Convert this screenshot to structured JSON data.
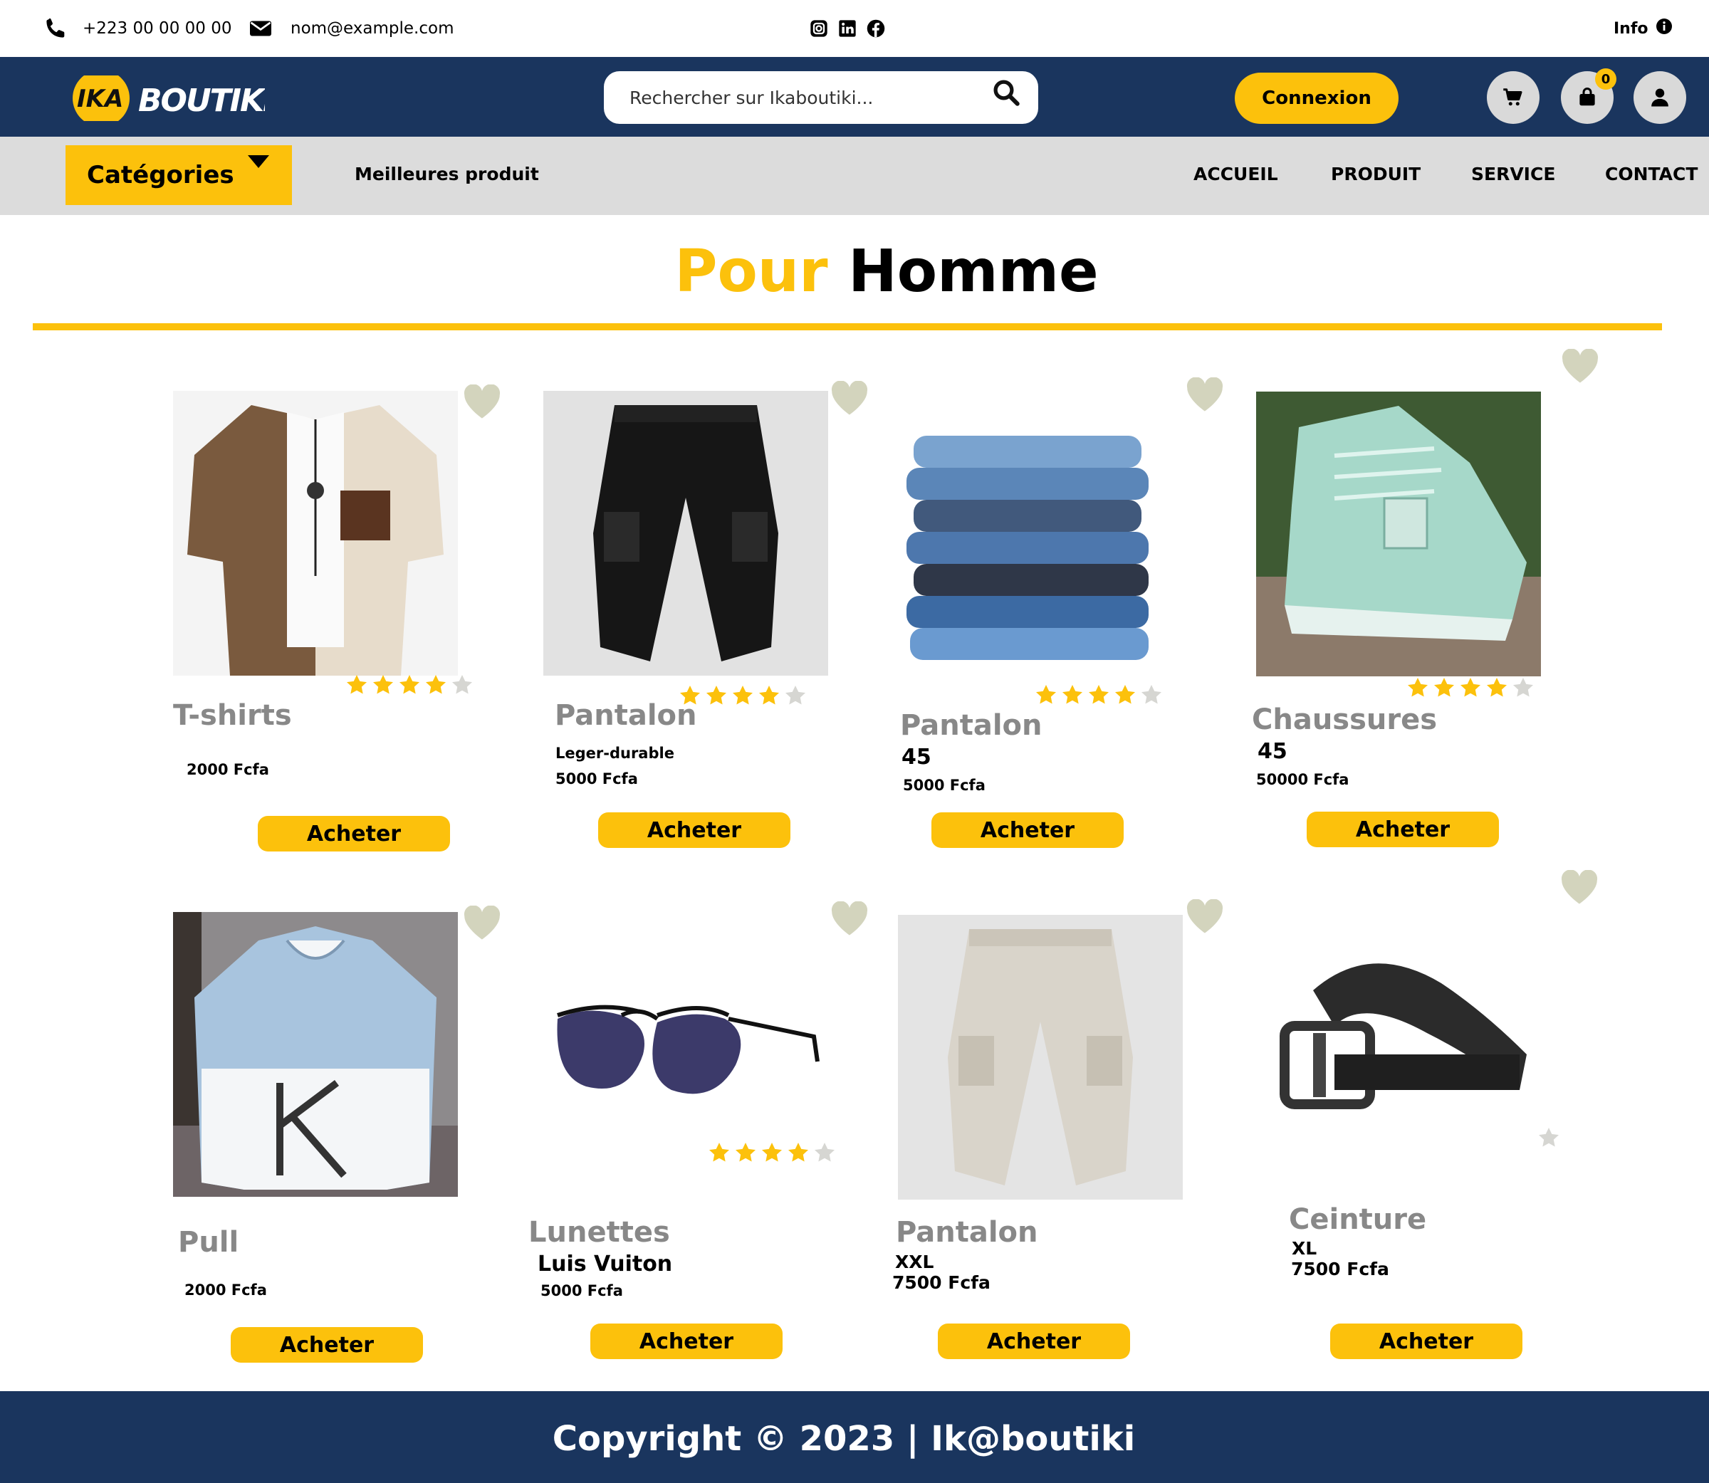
{
  "topbar": {
    "phone": "+223 00 00 00 00",
    "email": "nom@example.com",
    "social_icons": [
      "instagram-icon",
      "linkedin-icon",
      "facebook-icon"
    ],
    "info_label": "Info"
  },
  "header": {
    "logo_alt": "IKA BOUTIKI",
    "search_placeholder": "Rechercher sur Ikaboutiki...",
    "login_label": "Connexion",
    "bag_count": "0"
  },
  "nav": {
    "categories_label": "Catégories",
    "best_label": "Meilleures produit",
    "menu": [
      "ACCUEIL",
      "PRODUIT",
      "SERVICE",
      "CONTACT"
    ]
  },
  "section": {
    "title_part1": "Pour",
    "title_part2": "Homme"
  },
  "products": [
    {
      "name": "T-shirts",
      "detail": "",
      "price": "2000 Fcfa",
      "rating": 4,
      "buy": "Acheter"
    },
    {
      "name": "Pantalon",
      "detail": "Leger-durable",
      "price": "5000 Fcfa",
      "rating": 4,
      "buy": "Acheter"
    },
    {
      "name": "Pantalon",
      "detail": "45",
      "price": "5000 Fcfa",
      "rating": 4,
      "buy": "Acheter"
    },
    {
      "name": "Chaussures",
      "detail": "45",
      "price": "50000 Fcfa",
      "rating": 4,
      "buy": "Acheter"
    },
    {
      "name": "Pull",
      "detail": "",
      "price": "2000 Fcfa",
      "rating": null,
      "buy": "Acheter"
    },
    {
      "name": "Lunettes",
      "detail": "Luis Vuiton",
      "price": "5000 Fcfa",
      "rating": 4,
      "buy": "Acheter"
    },
    {
      "name": "Pantalon",
      "detail": "XXL",
      "price": "7500 Fcfa",
      "rating": null,
      "buy": "Acheter"
    },
    {
      "name": "Ceinture",
      "detail": "XL",
      "price": "7500 Fcfa",
      "rating": 0,
      "buy": "Acheter"
    }
  ],
  "footer": {
    "copyright": "Copyright © 2023 | Ik@boutiki"
  },
  "colors": {
    "navy": "#1a355e",
    "accent": "#fcc10c",
    "nav_gray": "#dcdcdc",
    "heart": "#d3d4bd"
  }
}
